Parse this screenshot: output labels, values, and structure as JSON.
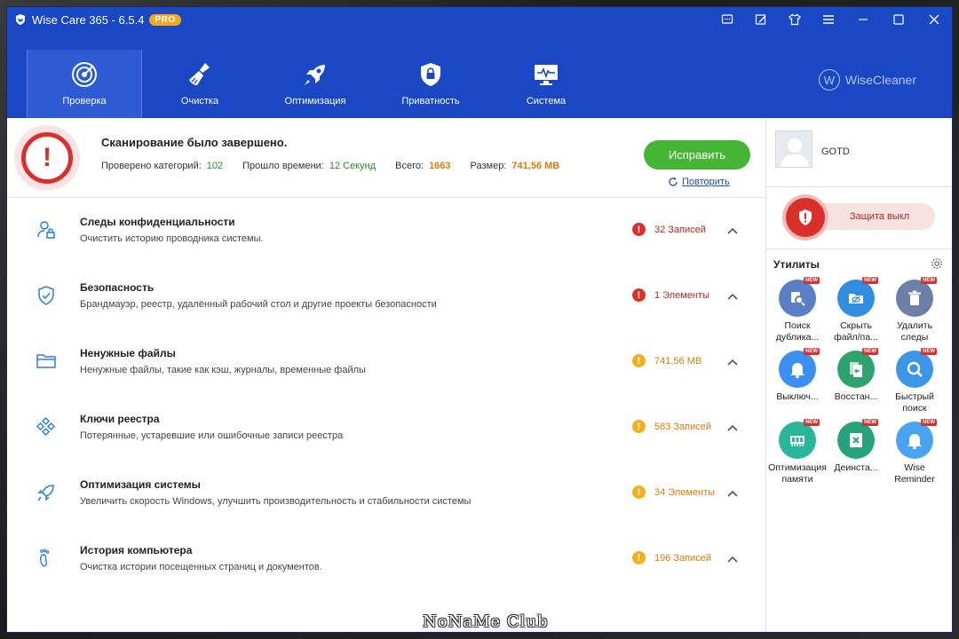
{
  "window": {
    "title": "Wise Care 365 - 6.5.4",
    "badge": "PRO",
    "controls": [
      "chat-icon",
      "edit-icon",
      "shirt-icon",
      "menu-icon",
      "minimize-icon",
      "maximize-icon",
      "close-icon"
    ]
  },
  "nav": {
    "tabs": [
      {
        "label": "Проверка",
        "icon": "radar-icon",
        "active": true
      },
      {
        "label": "Очистка",
        "icon": "broom-icon",
        "active": false
      },
      {
        "label": "Оптимизация",
        "icon": "rocket-icon",
        "active": false
      },
      {
        "label": "Приватность",
        "icon": "lock-icon",
        "active": false
      },
      {
        "label": "Система",
        "icon": "monitor-icon",
        "active": false
      }
    ],
    "brand": "WiseCleaner",
    "brand_letter": "W"
  },
  "summary": {
    "title": "Сканирование было завершено.",
    "checked_label": "Проверено категорий:",
    "checked_value": "102",
    "elapsed_label": "Прошло времени:",
    "elapsed_value": "12 Секунд",
    "total_label": "Всего:",
    "total_value": "1663",
    "size_label": "Размер:",
    "size_value": "741,56 MB",
    "fix_label": "Исправить",
    "repeat_label": "Повторить",
    "alert_glyph": "!"
  },
  "rows": [
    {
      "title": "Следы конфиденциальности",
      "desc": "Очистить историю проводника системы.",
      "status": "32 Записей",
      "level": "red",
      "icon": "user-lock-icon"
    },
    {
      "title": "Безопасность",
      "desc": "Брандмауэр, реестр, удалённый рабочий стол и другие проекты безопасности",
      "status": "1 Элементы",
      "level": "red",
      "icon": "shield-check-icon"
    },
    {
      "title": "Ненужные файлы",
      "desc": "Ненужные файлы, такие как кэш, журналы, временные файлы",
      "status": "741,56 MB",
      "level": "yellow",
      "icon": "folder-icon"
    },
    {
      "title": "Ключи реестра",
      "desc": "Потерянные, устаревшие или ошибочные записи реестра",
      "status": "583 Записей",
      "level": "yellow",
      "icon": "registry-icon"
    },
    {
      "title": "Оптимизация системы",
      "desc": "Увеличить скорость Windows, улучшить производительность и стабильности системы",
      "status": "34 Элементы",
      "level": "yellow",
      "icon": "rocket-outline-icon"
    },
    {
      "title": "История компьютера",
      "desc": "Очистка истории посещенных страниц и документов.",
      "status": "196 Записей",
      "level": "yellow",
      "icon": "footprint-icon"
    }
  ],
  "side": {
    "username": "GOTD",
    "protection_label": "Защита выкл",
    "utils_title": "Утилиты",
    "tools": [
      {
        "line1": "Поиск",
        "line2": "дублика...",
        "color": "#5b7fc7",
        "icon": "duplicate-search-icon",
        "new": "NEW"
      },
      {
        "line1": "Скрыть",
        "line2": "файл/па...",
        "color": "#2f8ee0",
        "icon": "hide-folder-icon",
        "new": "NEW"
      },
      {
        "line1": "Удалить",
        "line2": "следы",
        "color": "#6c7fa6",
        "icon": "trash-icon",
        "new": "NEW"
      },
      {
        "line1": "Выключ...",
        "line2": "",
        "color": "#3b8ff0",
        "icon": "bell-icon",
        "new": "NEW"
      },
      {
        "line1": "Восстан...",
        "line2": "",
        "color": "#2fa36e",
        "icon": "restore-icon",
        "new": "NEW"
      },
      {
        "line1": "Быстрый",
        "line2": "поиск",
        "color": "#3c96e8",
        "icon": "quick-search-icon",
        "new": "NEW"
      },
      {
        "line1": "Оптимизация",
        "line2": "памяти",
        "color": "#2bb59a",
        "icon": "memory-icon",
        "new": "NEW"
      },
      {
        "line1": "Деинста...",
        "line2": "",
        "color": "#26a37a",
        "icon": "uninstall-icon",
        "new": "NEW"
      },
      {
        "line1": "Wise",
        "line2": "Reminder",
        "color": "#4aa3f0",
        "icon": "reminder-bell-icon",
        "new": "NEW"
      }
    ]
  },
  "watermark": "NoNaMe Club"
}
